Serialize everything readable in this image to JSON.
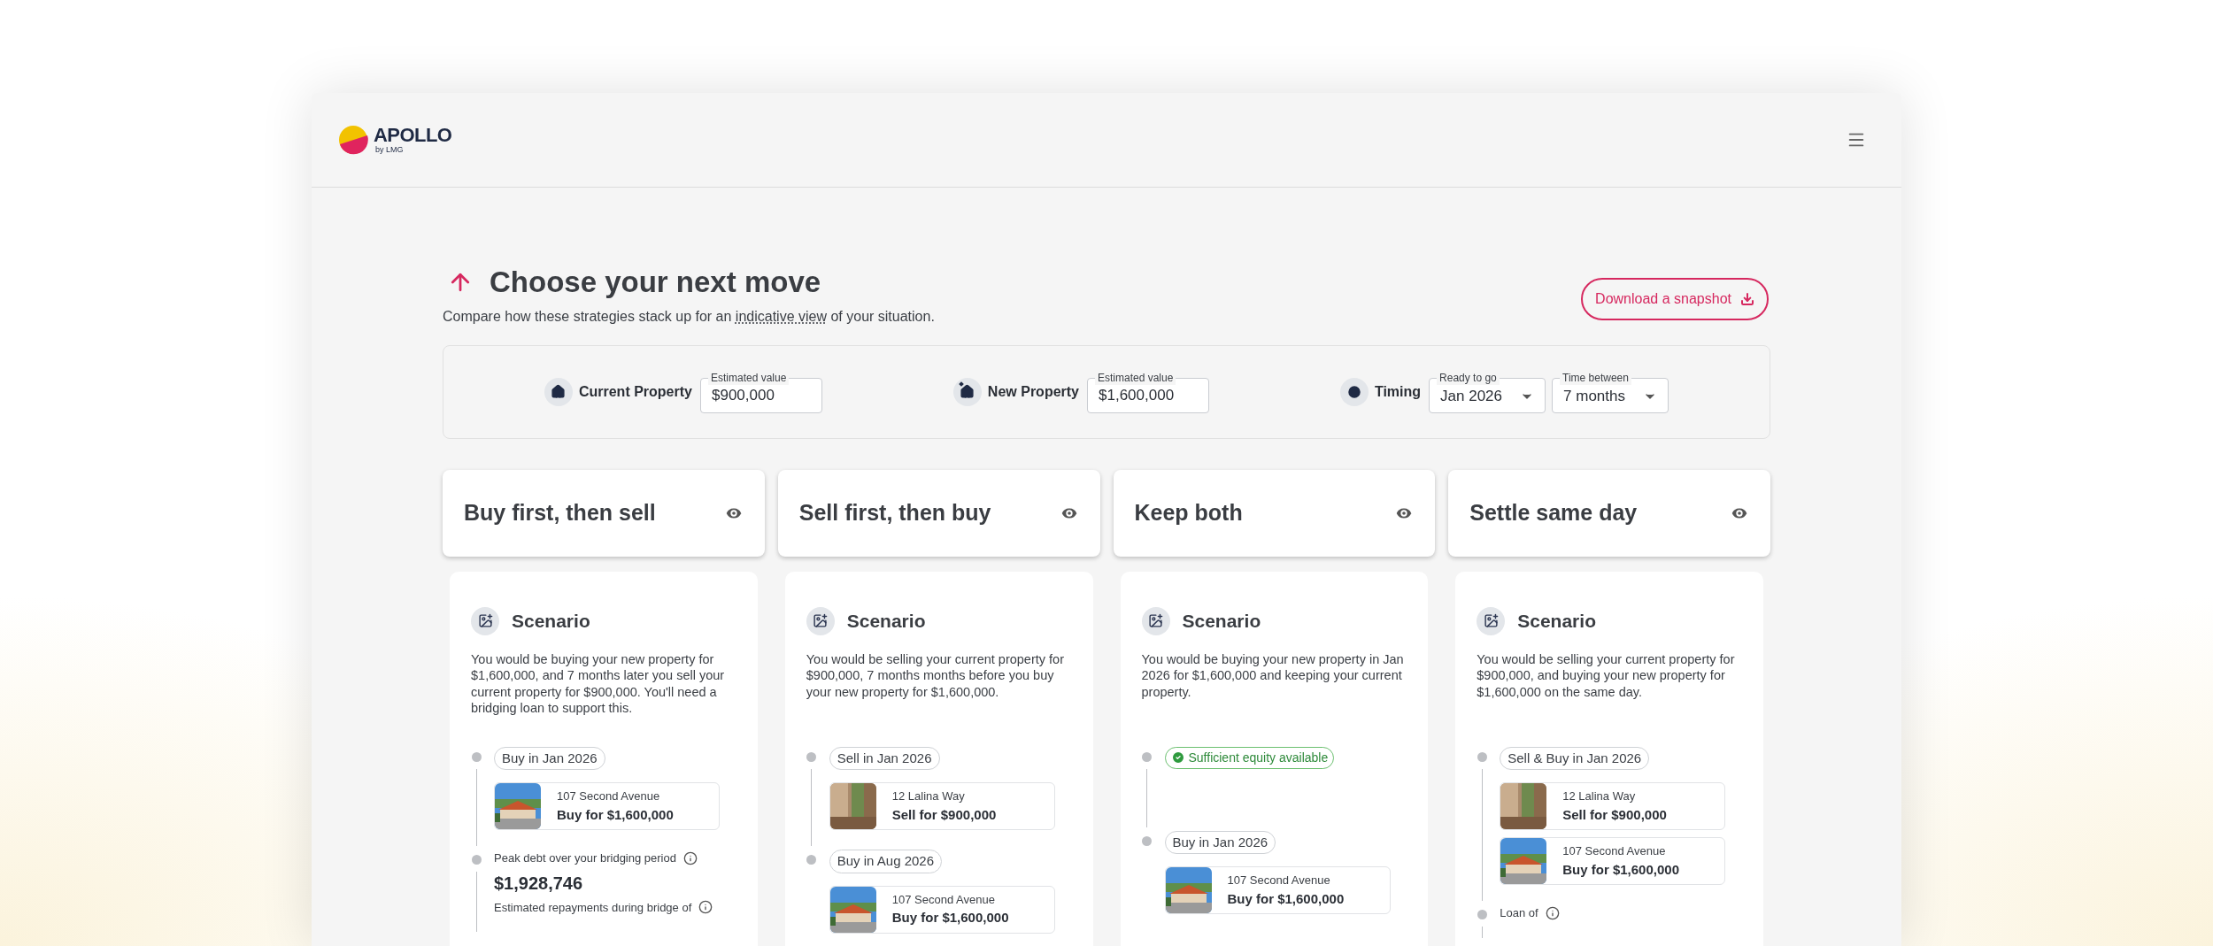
{
  "header": {
    "logo": {
      "name": "APOLLO",
      "byline": "by LMG"
    }
  },
  "page": {
    "title": "Choose your next move",
    "subtitle": {
      "before": "Compare how these strategies stack up for an ",
      "link": "indicative view",
      "after": " of your situation."
    },
    "download_button": "Download a snapshot"
  },
  "filters": [
    {
      "kind": "current",
      "label": "Current Property",
      "fields": [
        {
          "label": "Estimated value",
          "value": "$900,000",
          "dropdown": false
        }
      ]
    },
    {
      "kind": "new",
      "label": "New Property",
      "fields": [
        {
          "label": "Estimated value",
          "value": "$1,600,000",
          "dropdown": false
        }
      ]
    },
    {
      "kind": "timing",
      "label": "Timing",
      "fields": [
        {
          "label": "Ready to go",
          "value": "Jan 2026",
          "dropdown": true
        },
        {
          "label": "Time between",
          "value": "7 months",
          "dropdown": true
        }
      ]
    }
  ],
  "strategies": [
    {
      "title": "Buy first, then sell",
      "heading": "Scenario",
      "description": "You would be buying your new property for $1,600,000, and 7 months later you sell your current property for $900,000. You'll need a bridging loan to support this.",
      "steps": [
        {
          "kind": "event",
          "label": "Buy in Jan 2026",
          "properties": [
            {
              "kind": "buy",
              "address": "107 Second Avenue",
              "action": "Buy for $1,600,000"
            }
          ]
        },
        {
          "kind": "metric",
          "label": "Peak debt over your bridging period",
          "value": "$1,928,746",
          "note": "Estimated repayments during bridge of"
        }
      ]
    },
    {
      "title": "Sell first, then buy",
      "heading": "Scenario",
      "description": "You would be selling your current property for $900,000, 7 months months before you buy your new property for $1,600,000.",
      "steps": [
        {
          "kind": "event",
          "label": "Sell in Jan 2026",
          "properties": [
            {
              "kind": "sell",
              "address": "12 Lalina Way",
              "action": "Sell for $900,000"
            }
          ]
        },
        {
          "kind": "event",
          "label": "Buy in Aug 2026",
          "properties": [
            {
              "kind": "buy",
              "address": "107 Second Avenue",
              "action": "Buy for $1,600,000"
            }
          ]
        }
      ]
    },
    {
      "title": "Keep both",
      "heading": "Scenario",
      "description": "You would be buying your new property in Jan 2026 for $1,600,000 and keeping your current property.",
      "steps": [
        {
          "kind": "status",
          "label": "Sufficient equity available"
        },
        {
          "kind": "event",
          "label": "Buy in Jan 2026",
          "properties": [
            {
              "kind": "buy",
              "address": "107 Second Avenue",
              "action": "Buy for $1,600,000"
            }
          ]
        }
      ]
    },
    {
      "title": "Settle same day",
      "heading": "Scenario",
      "description": "You would be selling your current property for $900,000, and buying your new property for $1,600,000 on the same day.",
      "steps": [
        {
          "kind": "event",
          "label": "Sell & Buy in Jan 2026",
          "properties": [
            {
              "kind": "sell",
              "address": "12 Lalina Way",
              "action": "Sell for $900,000"
            },
            {
              "kind": "buy",
              "address": "107 Second Avenue",
              "action": "Buy for $1,600,000"
            }
          ]
        },
        {
          "kind": "metric",
          "label": "Loan of"
        }
      ]
    }
  ]
}
